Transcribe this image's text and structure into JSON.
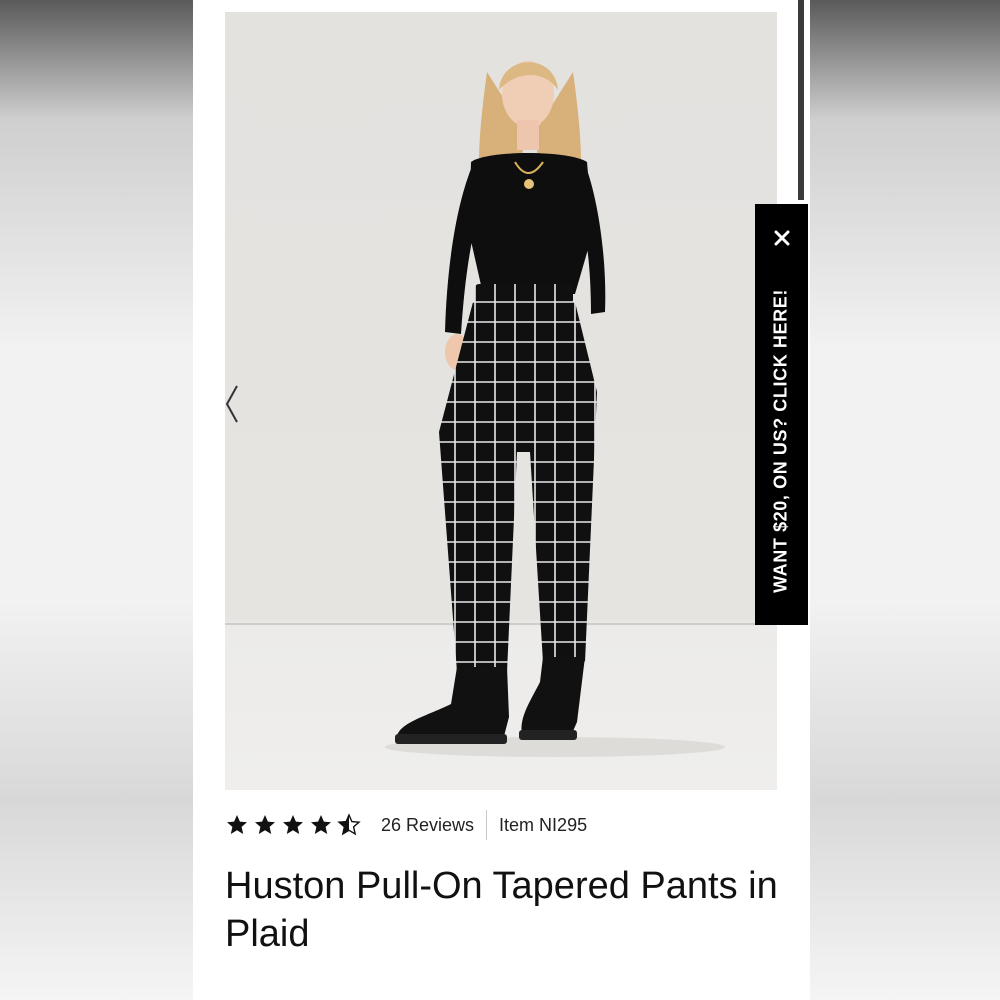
{
  "promo": {
    "text": "WANT $20, ON US? CLICK HERE!",
    "close_icon": "close-icon"
  },
  "product": {
    "rating": 4.5,
    "rating_max": 5,
    "reviews": "26 Reviews",
    "item": "Item NI295",
    "title": "Huston Pull-On Tapered Pants in Plaid"
  },
  "gallery": {
    "prev_icon": "chevron-left-icon"
  },
  "colors": {
    "promo_bg": "#000000",
    "text": "#111111"
  }
}
